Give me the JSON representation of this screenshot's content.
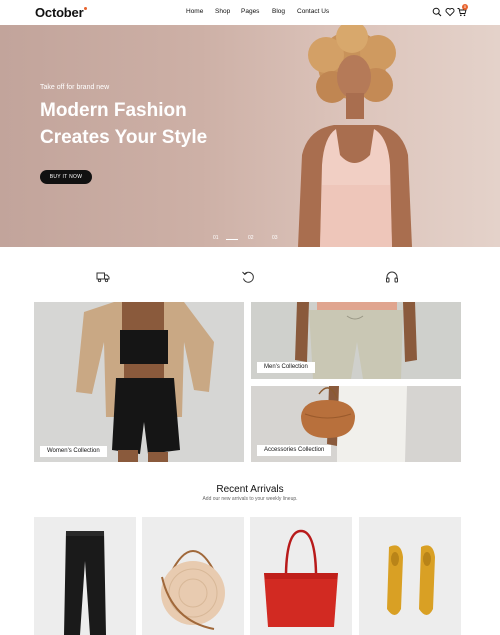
{
  "header": {
    "logo": "October",
    "nav": [
      {
        "label": "Home"
      },
      {
        "label": "Shop"
      },
      {
        "label": "Pages"
      },
      {
        "label": "Blog"
      },
      {
        "label": "Contact Us"
      }
    ],
    "icons": [
      "search-icon",
      "heart-icon",
      "cart-icon"
    ],
    "cart_count": "0"
  },
  "hero": {
    "kicker": "Take off for brand new",
    "title": "Modern Fashion Creates Your Style",
    "button": "BUY IT NOW",
    "slides": [
      "01",
      "02",
      "03"
    ],
    "active_slide": 1
  },
  "features": [
    "truck-icon",
    "return-icon",
    "headphones-icon"
  ],
  "collections": [
    {
      "label": "Women's Collection"
    },
    {
      "label": "Men's Collection"
    },
    {
      "label": "Accessories Collection"
    }
  ],
  "recent": {
    "title": "Recent Arrivals",
    "subtitle": "Add our new arrivals to your weekly lineup."
  },
  "colors": {
    "accent": "#e8632e",
    "hero_bg": "#c9aca2",
    "button_bg": "#111111"
  }
}
